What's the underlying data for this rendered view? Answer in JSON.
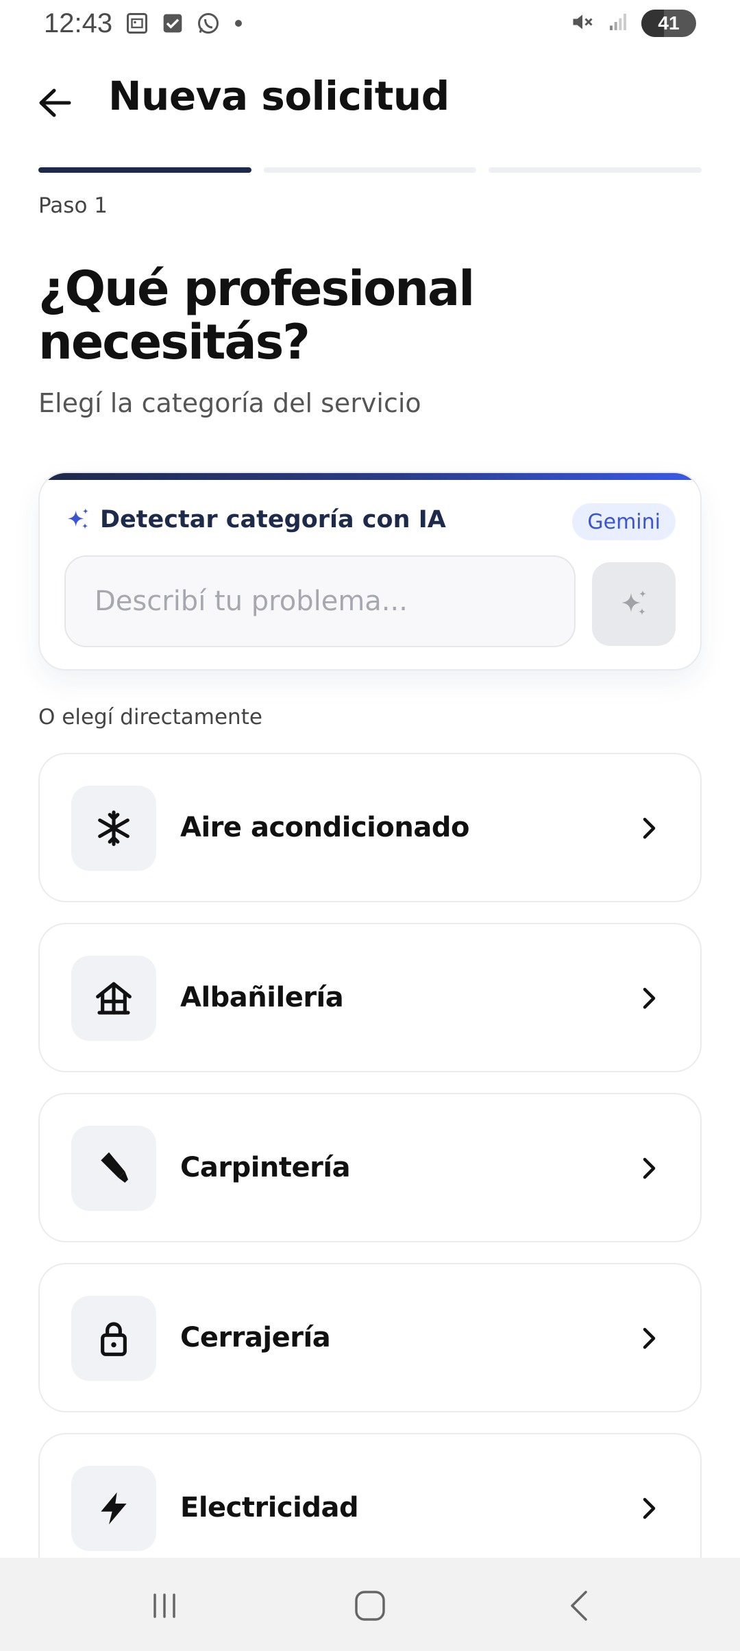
{
  "status_bar": {
    "time": "12:43",
    "battery_level": "41",
    "battery_fraction": 0.41,
    "left_icons": [
      "gallery-icon",
      "check-square-icon",
      "whatsapp-icon",
      "dot-icon"
    ],
    "right_icons": [
      "mute-icon",
      "signal-icon",
      "battery-icon"
    ]
  },
  "header": {
    "title": "Nueva solicitud"
  },
  "steps": {
    "label": "Paso 1",
    "current": 1,
    "total": 3
  },
  "main": {
    "title": "¿Qué profesional necesitás?",
    "subtitle": "Elegí la categoría del servicio"
  },
  "ai_card": {
    "title": "Detectar categoría con IA",
    "badge": "Gemini",
    "input_value": "",
    "input_placeholder": "Describí tu problema...",
    "accent_gradient": [
      "#1e2a4a",
      "#3a5ae8"
    ]
  },
  "categories": {
    "section_label": "O elegí directamente",
    "items": [
      {
        "label": "Aire acondicionado",
        "icon": "snowflake-icon"
      },
      {
        "label": "Albañilería",
        "icon": "house-frame-icon"
      },
      {
        "label": "Carpintería",
        "icon": "saw-icon"
      },
      {
        "label": "Cerrajería",
        "icon": "lock-icon"
      },
      {
        "label": "Electricidad",
        "icon": "lightning-icon"
      }
    ]
  },
  "nav_bar": {
    "buttons": [
      "recent-apps-icon",
      "home-icon",
      "back-nav-icon"
    ]
  },
  "colors": {
    "primary_dark": "#1e2a4a",
    "accent_blue": "#3a55d1",
    "badge_bg": "#eaefff"
  }
}
